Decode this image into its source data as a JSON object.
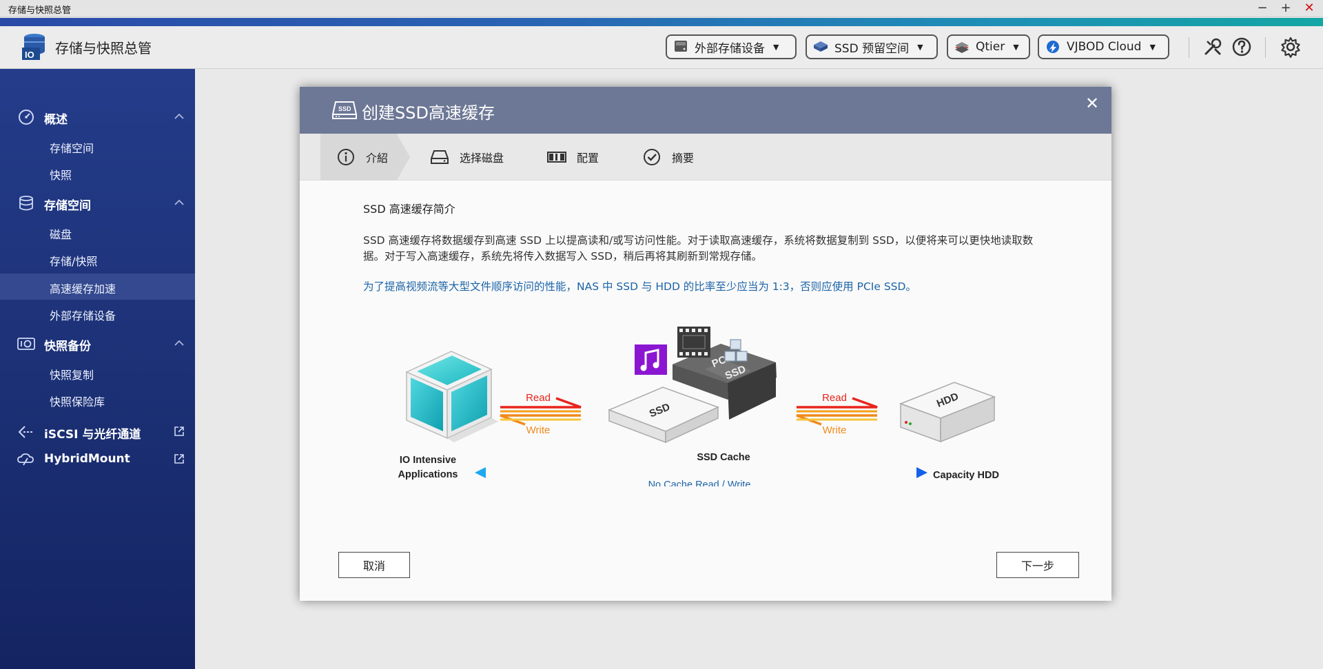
{
  "window": {
    "title": "存储与快照总管",
    "minimize": "−",
    "maximize": "+",
    "close": "✕"
  },
  "header": {
    "app_title": "存储与快照总管",
    "buttons": [
      {
        "label": "外部存储设备",
        "icon": "external-storage-icon"
      },
      {
        "label": "SSD 预留空间",
        "icon": "ssd-overprovision-icon"
      },
      {
        "label": "Qtier",
        "icon": "qtier-icon"
      },
      {
        "label": "VJBOD Cloud",
        "icon": "vjbod-cloud-icon"
      }
    ],
    "caret": "▼"
  },
  "sidebar": {
    "sections": [
      {
        "label": "概述",
        "icon": "dashboard-icon",
        "items": [
          "存储空间",
          "快照"
        ]
      },
      {
        "label": "存储空间",
        "icon": "database-icon",
        "items": [
          "磁盘",
          "存储/快照",
          "高速缓存加速",
          "外部存储设备"
        ]
      },
      {
        "label": "快照备份",
        "icon": "snapshot-icon",
        "items": [
          "快照复制",
          "快照保险库"
        ]
      }
    ],
    "links": [
      {
        "label": "iSCSI 与光纤通道",
        "icon": "iscsi-icon"
      },
      {
        "label": "HybridMount",
        "icon": "hybridmount-icon"
      }
    ],
    "active_item": "高速缓存加速"
  },
  "dialog": {
    "title": "创建SSD高速缓存",
    "close": "✕",
    "steps": [
      {
        "label": "介紹",
        "icon": "info-icon",
        "active": true
      },
      {
        "label": "选择磁盘",
        "icon": "disk-icon",
        "active": false
      },
      {
        "label": "配置",
        "icon": "config-icon",
        "active": false
      },
      {
        "label": "摘要",
        "icon": "check-circle-icon",
        "active": false
      }
    ],
    "intro_title": "SSD 高速缓存简介",
    "intro_p1": "SSD 高速缓存将数据缓存到高速 SSD 上以提高读和/或写访问性能。对于读取高速缓存，系统将数据复制到 SSD，以便将来可以更快地读取数据。对于写入高速缓存，系统先将传入数据写入 SSD，稍后再将其刷新到常规存储。",
    "intro_p2": "为了提高视频流等大型文件顺序访问的性能，NAS 中 SSD 与 HDD 的比率至少应当为 1:3，否则应使用 PCIe SSD。",
    "diagram": {
      "app_label_1": "IO Intensive",
      "app_label_2": "Applications",
      "read": "Read",
      "write": "Write",
      "ssd_label": "SSD",
      "pcie_label_1": "PCIe",
      "pcie_label_2": "SSD",
      "ssd_cache": "SSD Cache",
      "hdd_label": "HDD",
      "capacity_hdd": "Capacity HDD",
      "no_cache": "No Cache Read / Write"
    },
    "cancel": "取消",
    "next": "下一步"
  },
  "colors": {
    "sidebar_top": "#243c8a",
    "dialog_header": "#6d7896",
    "link_blue": "#1c64a8",
    "read_red": "#e8241c",
    "write_orange": "#f08a1c"
  }
}
